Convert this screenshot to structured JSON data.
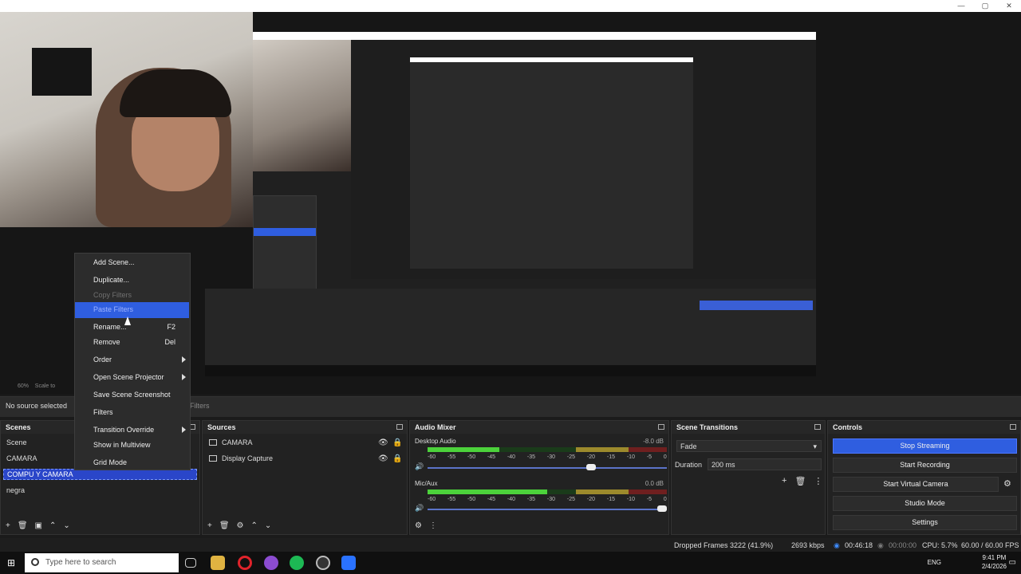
{
  "window": {
    "controls": [
      "—",
      "▢",
      "✕"
    ]
  },
  "preview": {
    "zoom": "60%",
    "scale_label": "Scale to"
  },
  "source_bar": {
    "no_source": "No source selected",
    "filters_tab": "Filters"
  },
  "scenes": {
    "title": "Scenes",
    "items": [
      "Scene",
      "CAMARA",
      "COMPU Y CAMARA",
      "negra"
    ],
    "selected": "COMPU Y CAMARA"
  },
  "sources": {
    "title": "Sources",
    "items": [
      "CAMARA",
      "Display Capture"
    ]
  },
  "mixer": {
    "title": "Audio Mixer",
    "channels": [
      {
        "name": "Desktop Audio",
        "db": "-8.0 dB",
        "level": 0.3,
        "volume": 0.69
      },
      {
        "name": "Mic/Aux",
        "db": "0.0 dB",
        "level": 0.5,
        "volume": 1.0
      }
    ],
    "ticks": [
      "-60",
      "-55",
      "-50",
      "-45",
      "-40",
      "-35",
      "-30",
      "-25",
      "-20",
      "-15",
      "-10",
      "-5",
      "0"
    ]
  },
  "transitions": {
    "title": "Scene Transitions",
    "selected": "Fade",
    "duration_label": "Duration",
    "duration_value": "200 ms"
  },
  "controls": {
    "title": "Controls",
    "stop_streaming": "Stop Streaming",
    "start_recording": "Start Recording",
    "start_virtual_camera": "Start Virtual Camera",
    "studio_mode": "Studio Mode",
    "settings": "Settings"
  },
  "context_menu": {
    "add_scene": "Add Scene...",
    "duplicate": "Duplicate...",
    "copy_filters": "Copy Filters",
    "paste_filters": "Paste Filters",
    "rename": "Rename...",
    "rename_shortcut": "F2",
    "remove": "Remove",
    "remove_shortcut": "Del",
    "order": "Order",
    "open_scene_projector": "Open Scene Projector",
    "save_scene_screenshot": "Save Scene Screenshot",
    "filters": "Filters",
    "transition_override": "Transition Override",
    "show_in_multiview": "Show in Multiview",
    "grid_mode": "Grid Mode"
  },
  "status": {
    "dropped_frames": "Dropped Frames 3222 (41.9%)",
    "bitrate": "2693 kbps",
    "stream_time": "00:46:18",
    "rec_time": "00:00:00",
    "cpu": "CPU: 5.7%",
    "fps": "60.00 / 60.00 FPS"
  },
  "taskbar": {
    "search_placeholder": "Type here to search",
    "language": "ENG",
    "time": "9:41 PM",
    "date": "2/4/2026"
  },
  "colors": {
    "accent": "#2f5ee0",
    "meter_green": "#4cd23b",
    "meter_yellow": "#9c8a2c",
    "meter_red": "#6f1f1f"
  }
}
